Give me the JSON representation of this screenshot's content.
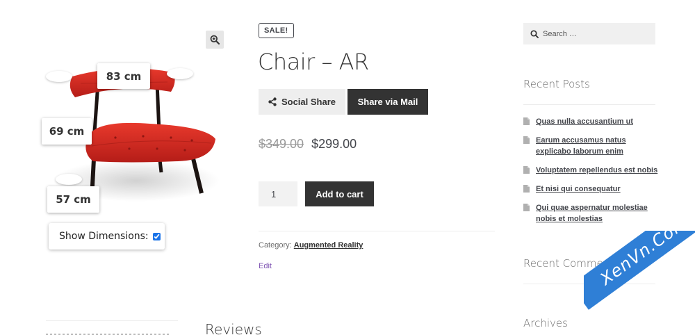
{
  "gallery": {
    "zoom_icon": "magnifier-plus-icon",
    "dimensions": {
      "width": "83 cm",
      "height": "69 cm",
      "depth": "57 cm"
    },
    "show_dimensions_label": "Show Dimensions:",
    "show_dimensions_checked": true,
    "chair_color": "#d42a22"
  },
  "product": {
    "badge": "SALE!",
    "title": "Chair – AR",
    "share_social_label": "Social Share",
    "share_mail_label": "Share via Mail",
    "price_old": "$349.00",
    "price_new": "$299.00",
    "quantity": "1",
    "add_to_cart_label": "Add to cart",
    "category_label": "Category:",
    "category_value": "Augmented Reality",
    "edit_label": "Edit"
  },
  "bottom": {
    "reviews_heading": "Reviews"
  },
  "sidebar": {
    "search_placeholder": "Search …",
    "recent_posts_title": "Recent Posts",
    "recent_posts": [
      "Quas nulla accusantium ut",
      "Earum accusamus natus explicabo laborum enim",
      "Voluptatem repellendus est nobis",
      "Et nisi qui consequatur",
      "Qui quae aspernatur molestiae nobis et molestias"
    ],
    "recent_comments_title": "Recent Comments",
    "archives_title": "Archives"
  },
  "watermark": {
    "text": "XenVn.Com",
    "color": "#2f7fd6"
  },
  "colors": {
    "dark_button": "#333333",
    "light_button": "#eeeeee",
    "link_purple": "#7f54b3"
  }
}
